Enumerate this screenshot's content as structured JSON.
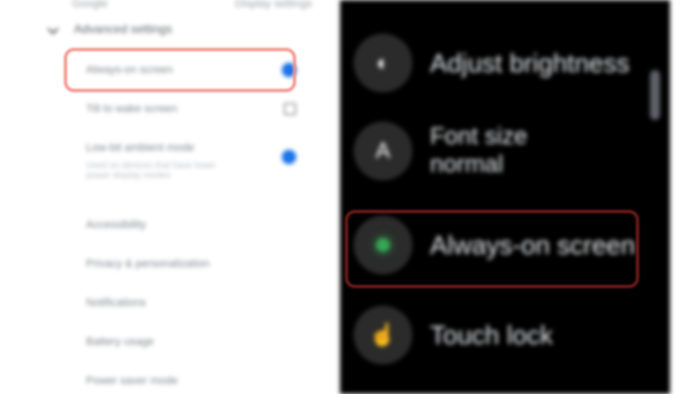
{
  "settings": {
    "topbar": {
      "left_text": "Google",
      "right_text": "Display settings"
    },
    "section_title": "Advanced settings",
    "rows": [
      {
        "label": "Always-on screen",
        "control": "dot"
      },
      {
        "label": "Tilt to wake screen",
        "control": "checkbox"
      },
      {
        "label": "Low-bit ambient mode",
        "control": "dot"
      }
    ],
    "subtext": "Used on devices that have lower power display modes",
    "more_items": [
      "Accessibility",
      "Privacy & personalization",
      "Notifications",
      "Battery usage",
      "Power saver mode"
    ]
  },
  "watch": {
    "items": [
      {
        "label": "Adjust brightness",
        "icon": "brightness-icon"
      },
      {
        "label_line1": "Font size",
        "label_line2": "normal",
        "icon": "font-size-icon"
      },
      {
        "label": "Always-on screen",
        "icon": "always-on-icon",
        "indicator": "green-dot"
      },
      {
        "label": "Touch lock",
        "icon": "touch-icon"
      }
    ]
  },
  "colors": {
    "accent_blue": "#1a73e8",
    "highlight_pink": "#f28b82",
    "highlight_dark_red": "#7a1d1d",
    "green": "#34a853"
  }
}
